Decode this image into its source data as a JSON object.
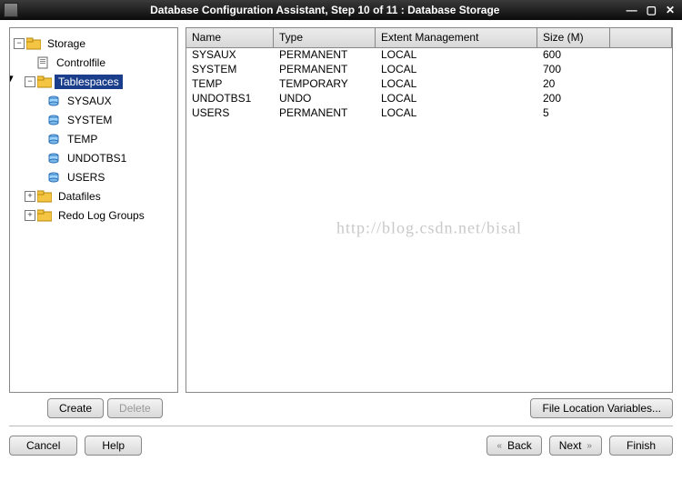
{
  "window": {
    "title": "Database Configuration Assistant, Step 10 of 11 : Database Storage"
  },
  "tree": {
    "root": "Storage",
    "controlfile": "Controlfile",
    "tablespaces": "Tablespaces",
    "children": [
      "SYSAUX",
      "SYSTEM",
      "TEMP",
      "UNDOTBS1",
      "USERS"
    ],
    "datafiles": "Datafiles",
    "redolog": "Redo Log Groups"
  },
  "table": {
    "headers": {
      "name": "Name",
      "type": "Type",
      "extent": "Extent Management",
      "size": "Size (M)"
    },
    "rows": [
      {
        "name": "SYSAUX",
        "type": "PERMANENT",
        "extent": "LOCAL",
        "size": "600"
      },
      {
        "name": "SYSTEM",
        "type": "PERMANENT",
        "extent": "LOCAL",
        "size": "700"
      },
      {
        "name": "TEMP",
        "type": "TEMPORARY",
        "extent": "LOCAL",
        "size": "20"
      },
      {
        "name": "UNDOTBS1",
        "type": "UNDO",
        "extent": "LOCAL",
        "size": "200"
      },
      {
        "name": "USERS",
        "type": "PERMANENT",
        "extent": "LOCAL",
        "size": "5"
      }
    ]
  },
  "watermark": "http://blog.csdn.net/bisal",
  "buttons": {
    "create": "Create",
    "delete": "Delete",
    "filelocvars": "File Location Variables...",
    "cancel": "Cancel",
    "help": "Help",
    "back": "Back",
    "next": "Next",
    "finish": "Finish"
  }
}
